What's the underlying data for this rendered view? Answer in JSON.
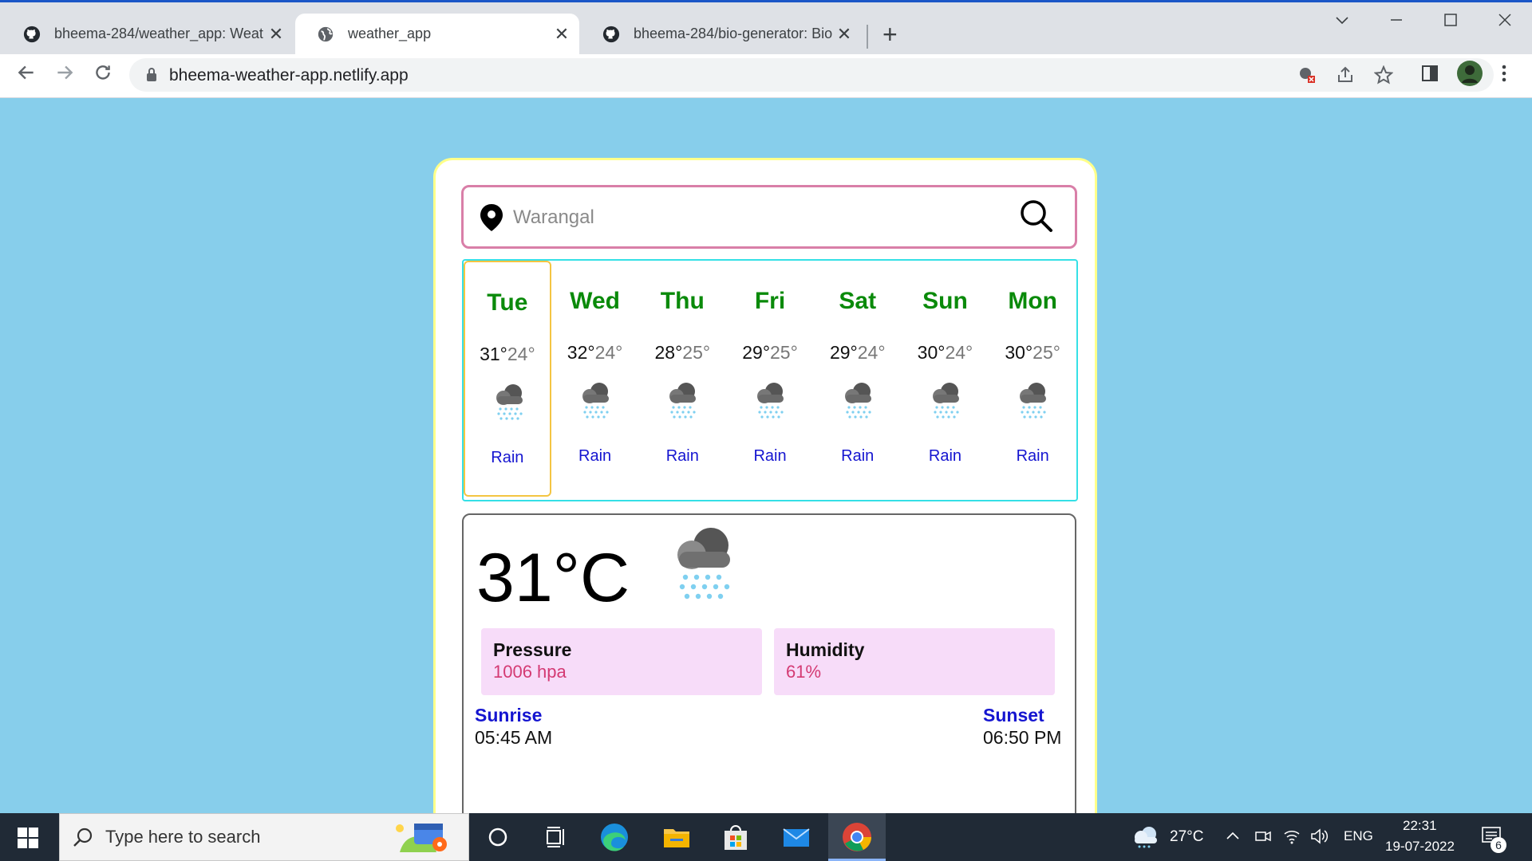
{
  "browser": {
    "tabs": [
      {
        "title": "bheema-284/weather_app: Weat",
        "icon": "github-icon",
        "active": false
      },
      {
        "title": "weather_app",
        "icon": "globe-icon",
        "active": true
      },
      {
        "title": "bheema-284/bio-generator: Bio",
        "icon": "github-icon",
        "active": false
      }
    ],
    "new_tab": "+",
    "close_glyph": "✕",
    "url": "bheema-weather-app.netlify.app"
  },
  "search": {
    "value": "",
    "placeholder": "Warangal"
  },
  "forecast": [
    {
      "day": "Tue",
      "high": "31°",
      "low": "24°",
      "condition": "Rain",
      "selected": true
    },
    {
      "day": "Wed",
      "high": "32°",
      "low": "24°",
      "condition": "Rain",
      "selected": false
    },
    {
      "day": "Thu",
      "high": "28°",
      "low": "25°",
      "condition": "Rain",
      "selected": false
    },
    {
      "day": "Fri",
      "high": "29°",
      "low": "25°",
      "condition": "Rain",
      "selected": false
    },
    {
      "day": "Sat",
      "high": "29°",
      "low": "24°",
      "condition": "Rain",
      "selected": false
    },
    {
      "day": "Sun",
      "high": "30°",
      "low": "24°",
      "condition": "Rain",
      "selected": false
    },
    {
      "day": "Mon",
      "high": "30°",
      "low": "25°",
      "condition": "Rain",
      "selected": false
    }
  ],
  "current": {
    "temp": "31°C",
    "pressure_label": "Pressure",
    "pressure_value": "1006 hpa",
    "humidity_label": "Humidity",
    "humidity_value": "61%",
    "sunrise_label": "Sunrise",
    "sunrise_value": "05:45 AM",
    "sunset_label": "Sunset",
    "sunset_value": "06:50 PM"
  },
  "taskbar": {
    "search_placeholder": "Type here to search",
    "weather": "27°C",
    "language": "ENG",
    "time": "22:31",
    "date": "19-07-2022",
    "notification_count": "6"
  },
  "colors": {
    "page_bg": "#87ceeb",
    "day_name": "#0a8a0a",
    "condition": "#1515d0",
    "stat_bg": "#f7dcf9",
    "stat_value": "#d43a73"
  }
}
